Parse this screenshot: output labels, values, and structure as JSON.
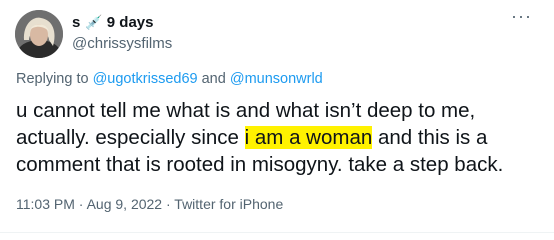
{
  "tweet": {
    "author": {
      "display_name": "s",
      "name_emoji": "💉",
      "handle": "@chrissysfilms"
    },
    "time_ago": "9 days",
    "more_icon": "more-horizontal-icon",
    "replying_to": {
      "prefix": "Replying to",
      "mention_1": "@ugotkrissed69",
      "conjunction": "and",
      "mention_2": "@munsonwrld"
    },
    "body": {
      "before_highlight": "u cannot tell me what is and what isn’t deep to me, actually. especially since ",
      "highlight": "i am a woman",
      "after_highlight": " and this is a comment that is rooted in misogyny. take a step back."
    },
    "meta": {
      "time": "11:03 PM",
      "separator_1": "·",
      "date": "Aug 9, 2022",
      "separator_2": "·",
      "source": "Twitter for iPhone"
    },
    "colors": {
      "link": "#1d9bf0",
      "secondary_text": "#536471",
      "highlight": "#fff200"
    }
  }
}
